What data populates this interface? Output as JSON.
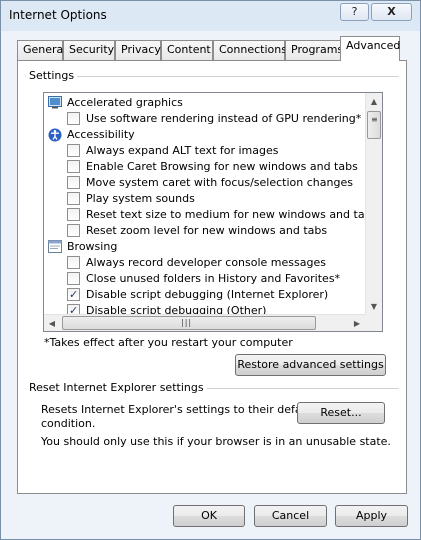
{
  "window": {
    "title": "Internet Options",
    "help_label": "?",
    "close_label": "X"
  },
  "tabs": [
    {
      "label": "General",
      "active": false
    },
    {
      "label": "Security",
      "active": false
    },
    {
      "label": "Privacy",
      "active": false
    },
    {
      "label": "Content",
      "active": false
    },
    {
      "label": "Connections",
      "active": false
    },
    {
      "label": "Programs",
      "active": false
    },
    {
      "label": "Advanced",
      "active": true
    }
  ],
  "settings": {
    "group_label": "Settings",
    "items": [
      {
        "type": "category",
        "icon": "display-icon",
        "label": "Accelerated graphics"
      },
      {
        "type": "checkbox",
        "checked": false,
        "label": "Use software rendering instead of GPU rendering*"
      },
      {
        "type": "category",
        "icon": "accessibility-icon",
        "label": "Accessibility"
      },
      {
        "type": "checkbox",
        "checked": false,
        "label": "Always expand ALT text for images"
      },
      {
        "type": "checkbox",
        "checked": false,
        "label": "Enable Caret Browsing for new windows and tabs"
      },
      {
        "type": "checkbox",
        "checked": false,
        "label": "Move system caret with focus/selection changes"
      },
      {
        "type": "checkbox",
        "checked": false,
        "label": "Play system sounds"
      },
      {
        "type": "checkbox",
        "checked": false,
        "label": "Reset text size to medium for new windows and tabs"
      },
      {
        "type": "checkbox",
        "checked": false,
        "label": "Reset zoom level for new windows and tabs"
      },
      {
        "type": "category",
        "icon": "browsing-icon",
        "label": "Browsing"
      },
      {
        "type": "checkbox",
        "checked": false,
        "label": "Always record developer console messages"
      },
      {
        "type": "checkbox",
        "checked": false,
        "label": "Close unused folders in History and Favorites*"
      },
      {
        "type": "checkbox",
        "checked": true,
        "label": "Disable script debugging (Internet Explorer)"
      },
      {
        "type": "checkbox",
        "checked": true,
        "label": "Disable script debugging (Other)"
      }
    ],
    "restart_note": "*Takes effect after you restart your computer",
    "restore_button": "Restore advanced settings"
  },
  "reset": {
    "group_label": "Reset Internet Explorer settings",
    "description": [
      "Resets Internet Explorer's settings to their default",
      "condition."
    ],
    "reset_button": "Reset...",
    "warning": "You should only use this if your browser is in an unusable state."
  },
  "footer": {
    "ok": "OK",
    "cancel": "Cancel",
    "apply": "Apply"
  },
  "colors": {
    "titlebar": "#dde8f5",
    "window_bg": "#eef3fa",
    "check_mark": "#1f3a6b"
  }
}
